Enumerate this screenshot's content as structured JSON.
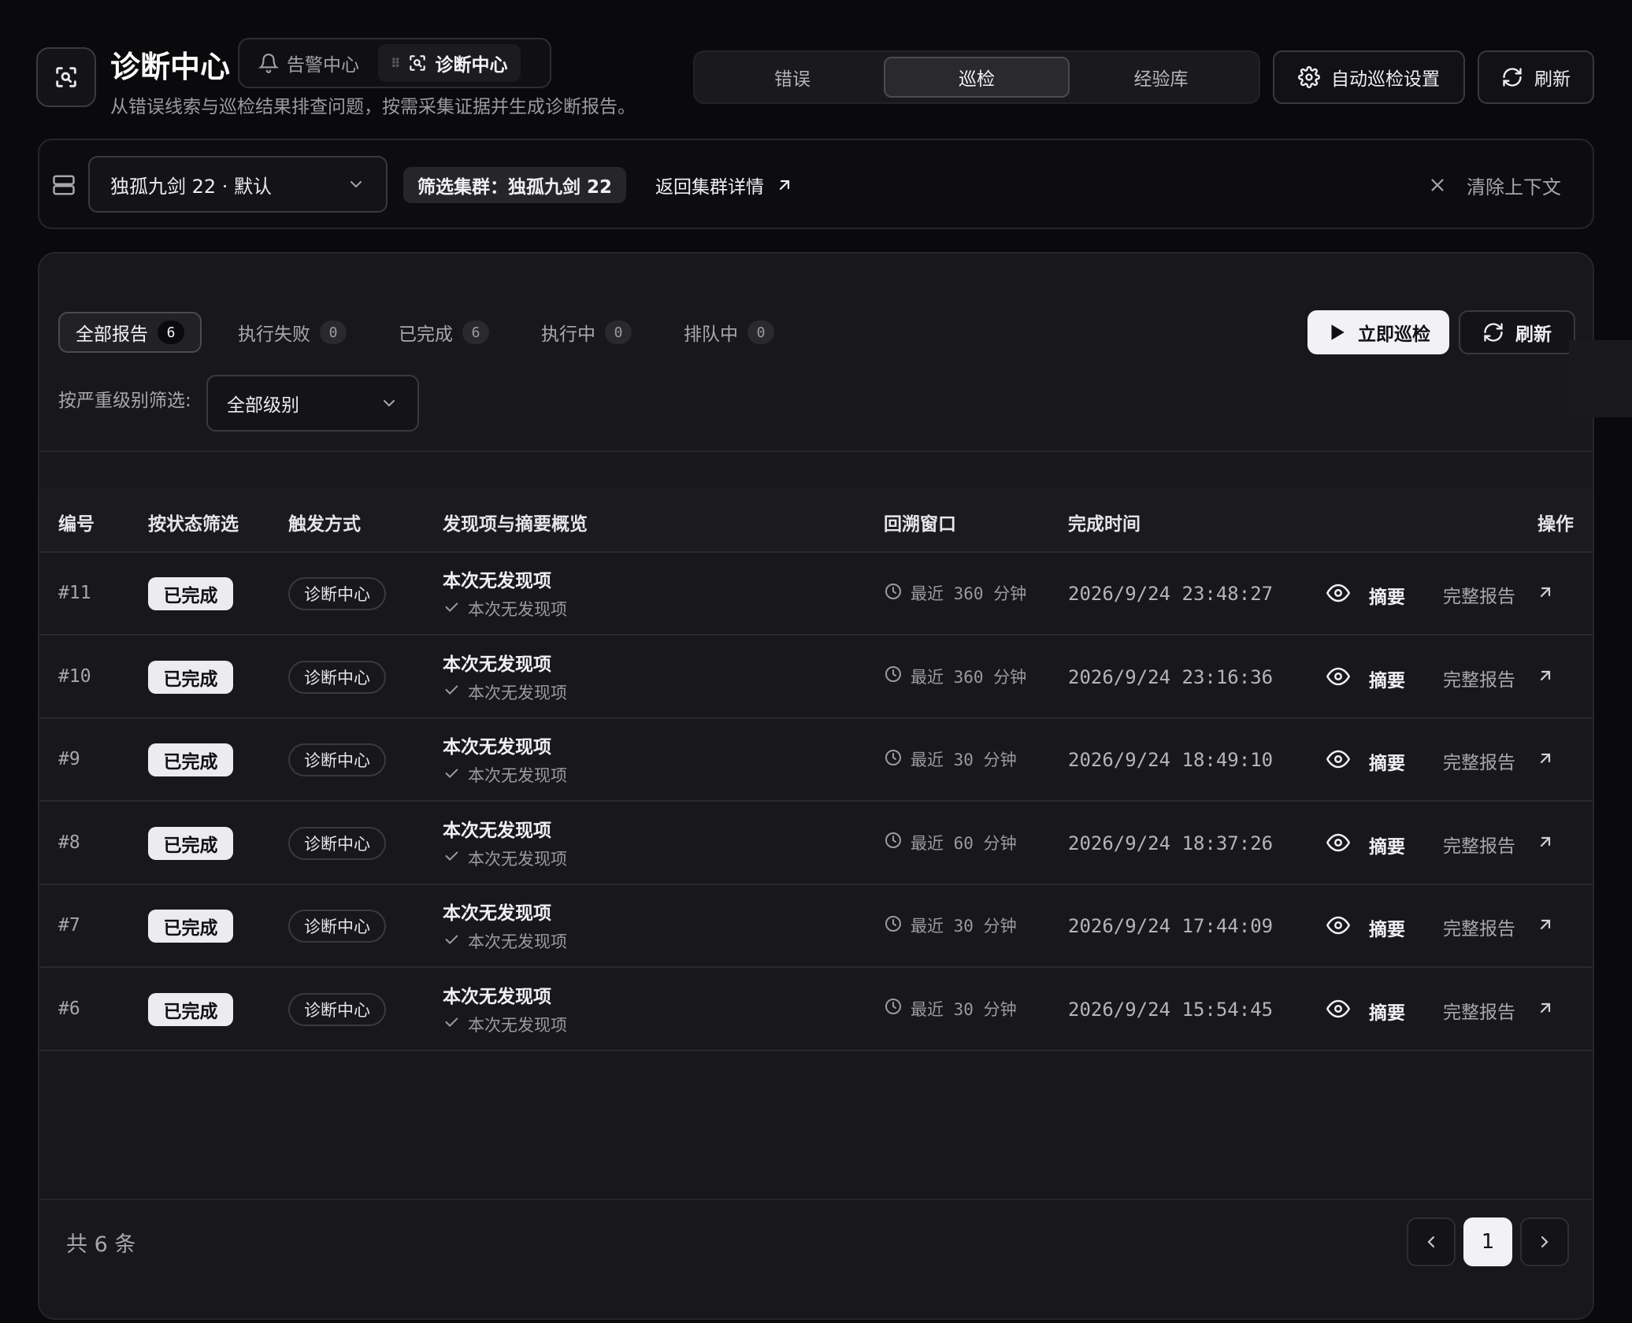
{
  "header": {
    "title": "诊断中心",
    "subtitle": "从错误线索与巡检结果排查问题，按需采集证据并生成诊断报告。",
    "switcher": [
      {
        "label": "告警中心",
        "icon": "bell-icon"
      },
      {
        "label": "诊断中心",
        "icon": "scan-search-icon"
      }
    ],
    "tabs": [
      "错误",
      "巡检",
      "经验库"
    ],
    "active_tab": "巡检",
    "auto_settings_label": "自动巡检设置",
    "refresh_label": "刷新"
  },
  "context": {
    "cluster_select": "独孤九剑 22 · 默认",
    "filter_chip": "筛选集群：独孤九剑 22",
    "back_link": "返回集群详情",
    "clear_label": "清除上下文"
  },
  "filters": {
    "tabs": [
      {
        "label": "全部报告",
        "count": "6"
      },
      {
        "label": "执行失败",
        "count": "0"
      },
      {
        "label": "已完成",
        "count": "6"
      },
      {
        "label": "执行中",
        "count": "0"
      },
      {
        "label": "排队中",
        "count": "0"
      }
    ],
    "run_now_label": "立即巡检",
    "refresh_label": "刷新",
    "severity_label": "按严重级别筛选:",
    "severity_value": "全部级别"
  },
  "table": {
    "columns": [
      "编号",
      "按状态筛选",
      "触发方式",
      "发现项与摘要概览",
      "回溯窗口",
      "完成时间",
      "操作"
    ],
    "rows": [
      {
        "id": "#11",
        "status": "已完成",
        "trigger": "诊断中心",
        "title": "本次无发现项",
        "summary": "本次无发现项",
        "window": "最近 360 分钟",
        "time": "2026/9/24 23:48:27",
        "summary_action": "摘要",
        "report_action": "完整报告"
      },
      {
        "id": "#10",
        "status": "已完成",
        "trigger": "诊断中心",
        "title": "本次无发现项",
        "summary": "本次无发现项",
        "window": "最近 360 分钟",
        "time": "2026/9/24 23:16:36",
        "summary_action": "摘要",
        "report_action": "完整报告"
      },
      {
        "id": "#9",
        "status": "已完成",
        "trigger": "诊断中心",
        "title": "本次无发现项",
        "summary": "本次无发现项",
        "window": "最近 30 分钟",
        "time": "2026/9/24 18:49:10",
        "summary_action": "摘要",
        "report_action": "完整报告"
      },
      {
        "id": "#8",
        "status": "已完成",
        "trigger": "诊断中心",
        "title": "本次无发现项",
        "summary": "本次无发现项",
        "window": "最近 60 分钟",
        "time": "2026/9/24 18:37:26",
        "summary_action": "摘要",
        "report_action": "完整报告"
      },
      {
        "id": "#7",
        "status": "已完成",
        "trigger": "诊断中心",
        "title": "本次无发现项",
        "summary": "本次无发现项",
        "window": "最近 30 分钟",
        "time": "2026/9/24 17:44:09",
        "summary_action": "摘要",
        "report_action": "完整报告"
      },
      {
        "id": "#6",
        "status": "已完成",
        "trigger": "诊断中心",
        "title": "本次无发现项",
        "summary": "本次无发现项",
        "window": "最近 30 分钟",
        "time": "2026/9/24 15:54:45",
        "summary_action": "摘要",
        "report_action": "完整报告"
      }
    ]
  },
  "pagination": {
    "total_label": "共 6 条",
    "current_page": "1"
  },
  "colors": {
    "background": "#0a0a0c",
    "card": "#18181b",
    "accent_button": "#f2f2f4",
    "status_badge": "#ececee"
  }
}
